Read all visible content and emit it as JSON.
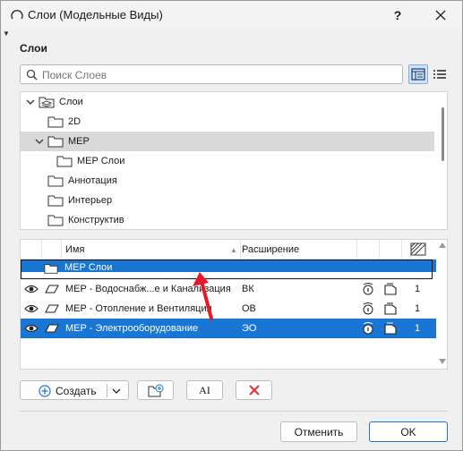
{
  "window": {
    "title": "Слои (Модельные Виды)",
    "help_label": "?",
    "close_label": "✕"
  },
  "section": {
    "label": "Слои"
  },
  "search": {
    "placeholder": "Поиск Слоев"
  },
  "tree": {
    "items": [
      {
        "label": "Слои",
        "level": 0,
        "expanded": true,
        "selected": false
      },
      {
        "label": "2D",
        "level": 1,
        "expanded": null,
        "selected": false
      },
      {
        "label": "MEP",
        "level": 1,
        "expanded": true,
        "selected": true
      },
      {
        "label": "MEP Слои",
        "level": 2,
        "expanded": null,
        "selected": false
      },
      {
        "label": "Аннотация",
        "level": 1,
        "expanded": null,
        "selected": false
      },
      {
        "label": "Интерьер",
        "level": 1,
        "expanded": null,
        "selected": false
      },
      {
        "label": "Конструктив",
        "level": 1,
        "expanded": null,
        "selected": false
      }
    ]
  },
  "layers": {
    "headers": {
      "name": "Имя",
      "extension": "Расширение"
    },
    "drop_folder": "MEP Слои",
    "rows": [
      {
        "name": "MEP - Водоснабж...е и Канализация",
        "ext": "ВК",
        "pen": "1",
        "selected": false
      },
      {
        "name": "MEP - Отопление и Вентиляция",
        "ext": "ОВ",
        "pen": "1",
        "selected": false
      },
      {
        "name": "MEP - Электрооборудование",
        "ext": "ЭО",
        "pen": "1",
        "selected": true
      }
    ]
  },
  "buttons": {
    "create": "Создать",
    "rename_glyph": "AI",
    "cancel": "Отменить",
    "ok": "OK"
  },
  "colors": {
    "selection": "#1976d2",
    "tree_selection": "#d9d9d9",
    "delete_red": "#e53935",
    "annotation_arrow": "#e8172b"
  }
}
